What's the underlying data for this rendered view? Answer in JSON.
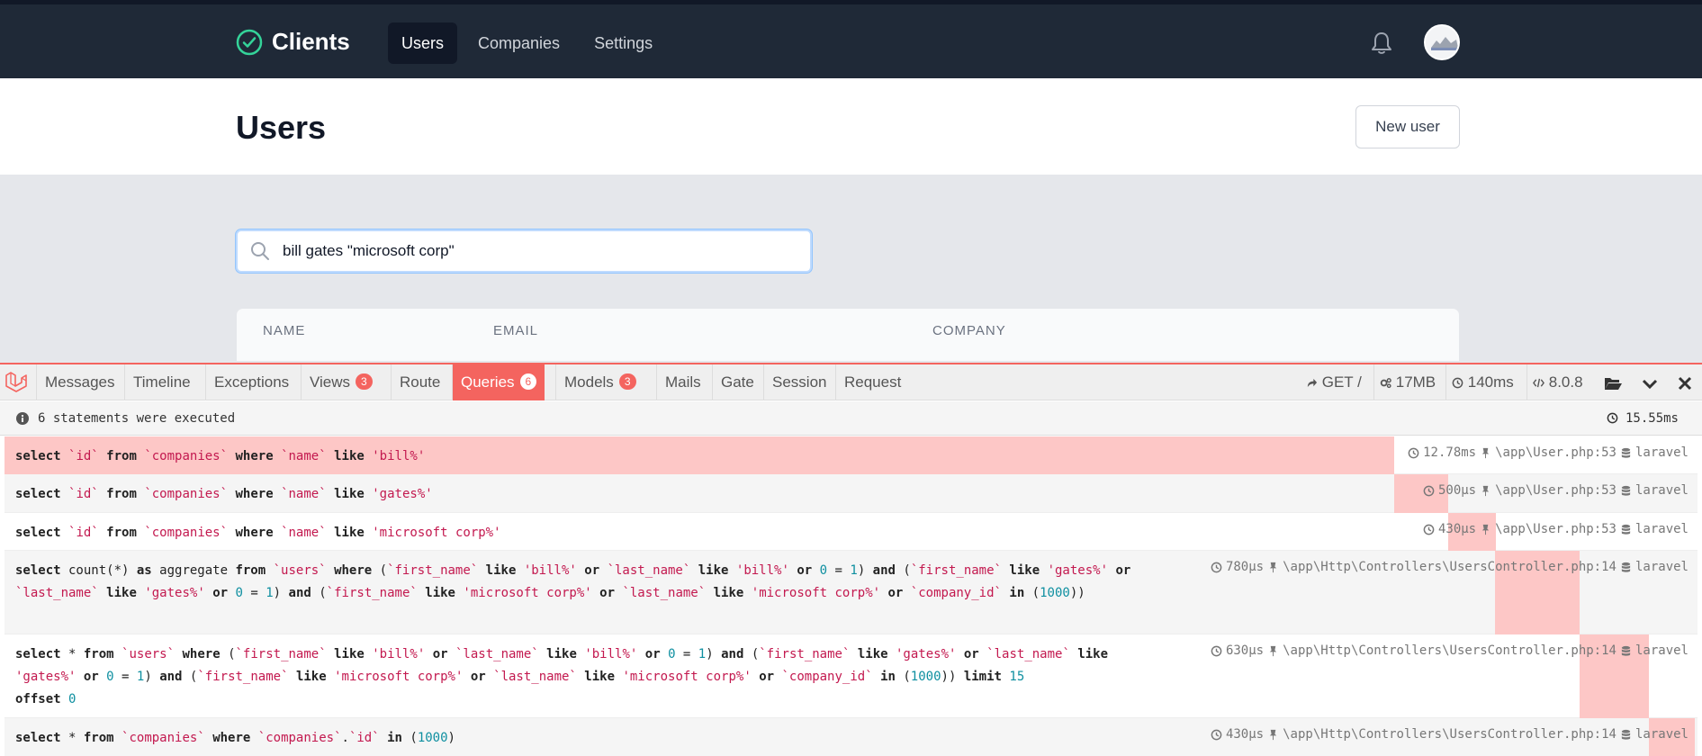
{
  "nav": {
    "brand": "Clients",
    "links": [
      {
        "label": "Users",
        "active": true
      },
      {
        "label": "Companies",
        "active": false
      },
      {
        "label": "Settings",
        "active": false
      }
    ]
  },
  "header": {
    "title": "Users",
    "new_user_label": "New user"
  },
  "search": {
    "value": "bill gates \"microsoft corp\"",
    "placeholder": ""
  },
  "table": {
    "columns": [
      "NAME",
      "EMAIL",
      "COMPANY"
    ]
  },
  "debugbar": {
    "tabs": [
      {
        "label": "Messages"
      },
      {
        "label": "Timeline"
      },
      {
        "label": "Exceptions"
      },
      {
        "label": "Views",
        "badge": "3"
      },
      {
        "label": "Route"
      },
      {
        "label": "Queries",
        "badge": "6",
        "active": true
      },
      {
        "label": "Models",
        "badge": "3"
      },
      {
        "label": "Mails"
      },
      {
        "label": "Gate"
      },
      {
        "label": "Session"
      },
      {
        "label": "Request"
      }
    ],
    "stats": {
      "method": "GET /",
      "memory": "17MB",
      "time": "140ms",
      "version": "8.0.8"
    },
    "summary": "6 statements were executed",
    "total_time": "15.55ms",
    "statements": [
      {
        "time": "12.78ms",
        "source": "\\app\\User.php:53",
        "connection": "laravel",
        "bar_offset": 0,
        "bar_fraction": 0.822
      },
      {
        "time": "500μs",
        "source": "\\app\\User.php:53",
        "connection": "laravel",
        "bar_offset": 0.822,
        "bar_fraction": 0.032
      },
      {
        "time": "430μs",
        "source": "\\app\\User.php:53",
        "connection": "laravel",
        "bar_offset": 0.854,
        "bar_fraction": 0.028
      },
      {
        "time": "780μs",
        "source": "\\app\\Http\\Controllers\\UsersController.php:14",
        "connection": "laravel",
        "bar_offset": 0.882,
        "bar_fraction": 0.05
      },
      {
        "time": "630μs",
        "source": "\\app\\Http\\Controllers\\UsersController.php:14",
        "connection": "laravel",
        "bar_offset": 0.932,
        "bar_fraction": 0.041
      },
      {
        "time": "430μs",
        "source": "\\app\\Http\\Controllers\\UsersController.php:14",
        "connection": "laravel",
        "bar_offset": 0.973,
        "bar_fraction": 0.027
      }
    ]
  }
}
